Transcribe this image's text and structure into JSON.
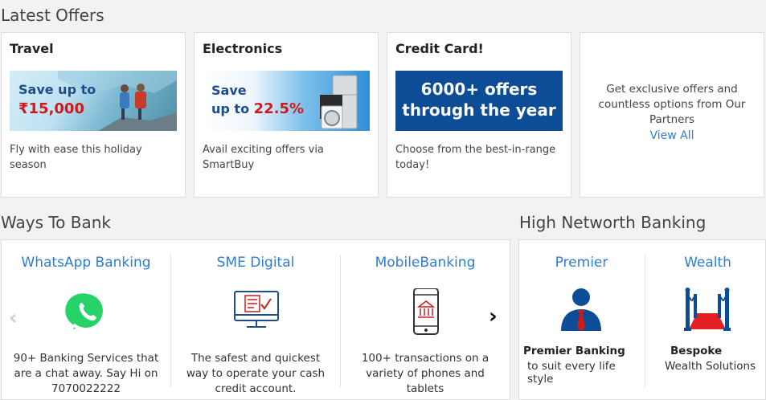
{
  "offers": {
    "section_title": "Latest Offers",
    "cards": [
      {
        "title": "Travel",
        "banner_line1": "Save up to",
        "banner_line2": "₹15,000",
        "description": "Fly with ease this holiday season"
      },
      {
        "title": "Electronics",
        "banner_line1": "Save",
        "banner_line2_prefix": "up to",
        "banner_line2_value": "22.5%",
        "description": "Avail exciting offers via SmartBuy"
      },
      {
        "title": "Credit Card!",
        "banner_line1": "6000+ offers",
        "banner_line2": "through the year",
        "description": "Choose from the best-in-range today!"
      }
    ],
    "partners_text": "Get exclusive offers and countless options from Our Partners",
    "partners_link": "View All"
  },
  "ways_to_bank": {
    "section_title": "Ways To Bank",
    "items": [
      {
        "title": "WhatsApp Banking",
        "icon": "whatsapp-icon",
        "description": "90+ Banking Services that are a chat away. Say Hi on 7070022222"
      },
      {
        "title": "SME Digital",
        "icon": "monitor-checklist-icon",
        "description": "The safest and quickest way to operate your cash credit account."
      },
      {
        "title": "MobileBanking",
        "icon": "mobile-bank-icon",
        "description": "100+ transactions on a variety of phones and tablets"
      }
    ],
    "prev_arrow": "‹",
    "next_arrow": "›"
  },
  "high_networth": {
    "section_title": "High Networth Banking",
    "items": [
      {
        "title": "Premier",
        "icon": "person-tie-icon",
        "line1": "Premier Banking",
        "line2": "to suit every life style"
      },
      {
        "title": "Wealth",
        "icon": "red-carpet-icon",
        "line1": "Bespoke",
        "line2": "Wealth Solutions"
      }
    ]
  },
  "colors": {
    "link": "#2d7ed5",
    "brand_blue": "#0d4c96",
    "accent_red": "#d01a1a",
    "whatsapp_green": "#25d366"
  }
}
